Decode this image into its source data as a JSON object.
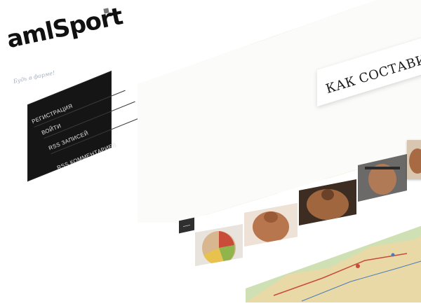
{
  "site": {
    "logo": "amlSport",
    "tagline": "Будь в форме!"
  },
  "menu": {
    "items": [
      {
        "label": "РЕГИСТРАЦИЯ"
      },
      {
        "label": "ВОЙТИ"
      },
      {
        "label": "RSS ЗАПИСЕЙ"
      },
      {
        "label": "RSS КОММЕНТАРИЕВ"
      }
    ]
  },
  "hero": {
    "banner": "КАК СОСТАВИТЬ",
    "prev_label": "—"
  },
  "thumbnails": [
    {
      "name": "food-wheel"
    },
    {
      "name": "muscle-front"
    },
    {
      "name": "muscle-back"
    },
    {
      "name": "gym-pose"
    },
    {
      "name": "athlete"
    }
  ],
  "colors": {
    "menu_bg": "#151515",
    "menu_text": "#e4e4e4",
    "tagline": "#a7b3c4",
    "logo": "#111111"
  }
}
